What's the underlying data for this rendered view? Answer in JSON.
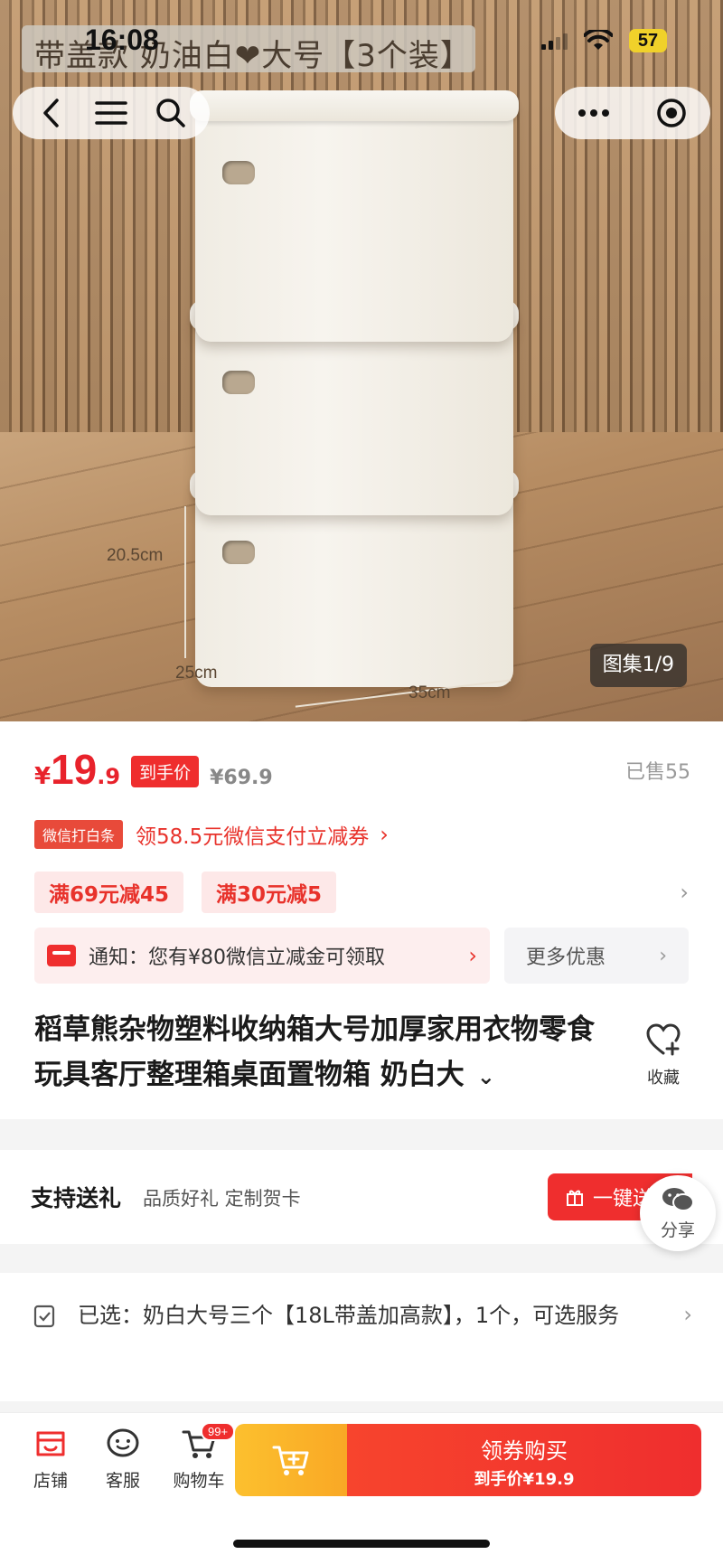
{
  "status_bar": {
    "time": "16:08",
    "battery": "57"
  },
  "hero": {
    "variant_title": "带盖款 奶油白❤大号【3个装】",
    "dimensions": {
      "height": "20.5cm",
      "depth": "25cm",
      "width": "35cm"
    },
    "gallery_badge": "图集1/9"
  },
  "nav": {
    "back_icon": "back-chevron-icon",
    "menu_icon": "menu-icon",
    "search_icon": "search-icon",
    "more_icon": "more-dots-icon",
    "close_icon": "target-icon"
  },
  "price": {
    "currency": "¥",
    "integer": "19",
    "decimal": ".9",
    "final_tag": "到手价",
    "original": "¥69.9",
    "sold": "已售55"
  },
  "coupon": {
    "badge": "微信打白条",
    "text": "领58.5元微信支付立减券",
    "arrow": "›"
  },
  "discounts": {
    "chips": [
      "满69元减45",
      "满30元减5"
    ],
    "more_arrow": "›"
  },
  "notice": {
    "text": "通知：您有¥80微信立减金可领取",
    "arrow": "›",
    "more_deals": "更多优惠",
    "more_arrow": "›"
  },
  "product": {
    "title": "稻草熊杂物塑料收纳箱大号加厚家用衣物零食玩具客厅整理箱桌面置物箱 奶白大",
    "expand_icon": "⌄",
    "favorite_label": "收藏"
  },
  "gift": {
    "title": "支持送礼",
    "subtitle": "品质好礼 定制贺卡",
    "button": "一键送",
    "share_label": "分享"
  },
  "spec": {
    "text": "已选：奶白大号三个【18L带盖加高款】，1个，可选服务",
    "arrow": "›"
  },
  "bottom_bar": {
    "tabs": [
      {
        "label": "店铺",
        "icon": "store-icon"
      },
      {
        "label": "客服",
        "icon": "customer-service-icon"
      },
      {
        "label": "购物车",
        "icon": "cart-icon",
        "badge": "99+"
      }
    ],
    "buy_main": "领券购买",
    "buy_sub": "到手价¥19.9"
  },
  "colors": {
    "accent_red": "#ef2e2e",
    "cart_yellow": "#f9a825"
  }
}
